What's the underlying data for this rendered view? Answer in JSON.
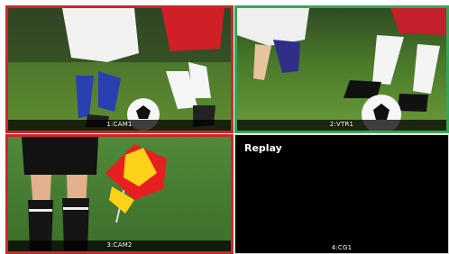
{
  "tiles": [
    {
      "label": "1:CAM1",
      "border_color": "#c8282a"
    },
    {
      "label": "2:VTR1",
      "border_color": "#3aa35a"
    },
    {
      "label": "3:CAM2",
      "border_color": "#c8282a"
    },
    {
      "label": "4:CG1",
      "border_color": "#000000",
      "title": "Replay"
    }
  ]
}
